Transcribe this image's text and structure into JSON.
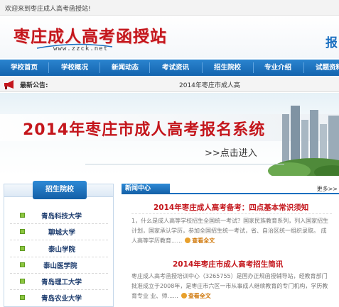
{
  "topbar": {
    "welcome": "欢迎来到枣庄成人高考函授站!"
  },
  "header": {
    "logo_text": "枣庄成人高考函授站",
    "logo_url": "www.zzck.net",
    "right_text": "报"
  },
  "nav": {
    "items": [
      {
        "label": "学校首页"
      },
      {
        "label": "学校概况"
      },
      {
        "label": "新闻动态"
      },
      {
        "label": "考试资讯"
      },
      {
        "label": "招生院校"
      },
      {
        "label": "专业介绍"
      },
      {
        "label": "试题资料"
      }
    ]
  },
  "announcement": {
    "label": "最新公告:",
    "text": "2014年枣庄市成人高"
  },
  "banner": {
    "title": "2014年枣庄市成人高考报名系统",
    "enter_label": ">>点击进入"
  },
  "sidebar": {
    "title": "招生院校",
    "schools": [
      {
        "name": "青岛科技大学"
      },
      {
        "name": "聊城大学"
      },
      {
        "name": "泰山学院"
      },
      {
        "name": "泰山医学院"
      },
      {
        "name": "青岛理工大学"
      },
      {
        "name": "青岛农业大学"
      }
    ]
  },
  "news": {
    "title": "新闻中心",
    "more": "更多>>",
    "articles": [
      {
        "title": "2014年枣庄成人高考备考：四点基本常识须知",
        "summary": "1，什么是成人高等学校招生全国统一考试？国家民族教育系列，列入国家招生计划，国家承认学历，参加全国招生统一考试，省、自治区统一组织录取。 成人高等学历教育......",
        "read_more": "查看全文"
      },
      {
        "title": "2014年枣庄市成人高考招生简讯",
        "summary": "枣庄成人高考函授培训中心（3265755）是国办正规函授辅导站，经教育部门批准成立于2008年，是枣庄市六区一市从事成人继续教育的专门机构，学历教育专业 业、师......",
        "read_more": "查看全文"
      }
    ]
  },
  "colors": {
    "brand_red": "#c4161c",
    "nav_blue": "#1a6fc0",
    "school_blue": "#1d3c6e",
    "read_more_orange": "#d0780b"
  }
}
